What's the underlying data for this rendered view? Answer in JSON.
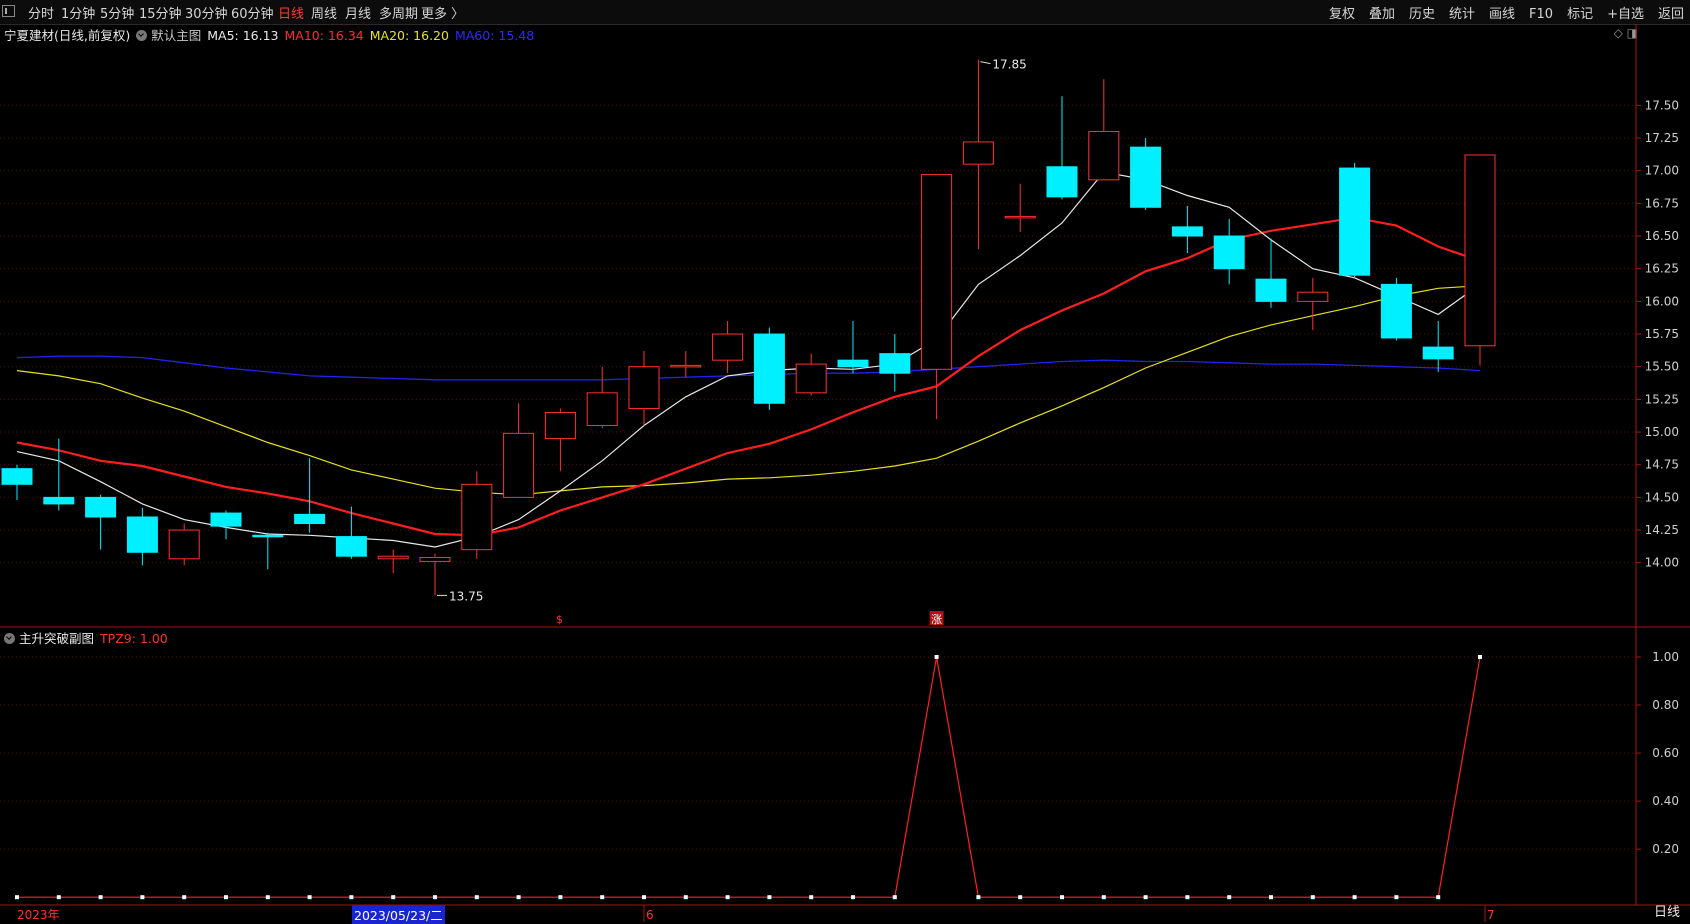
{
  "toolbar": {
    "left": [
      "分时",
      "1分钟",
      "5分钟",
      "15分钟",
      "30分钟",
      "60分钟",
      "日线",
      "周线",
      "月线",
      "多周期",
      "更多 〉"
    ],
    "active_index": 6,
    "right": [
      "复权",
      "叠加",
      "历史",
      "统计",
      "画线",
      "F10",
      "标记",
      "+自选",
      "返回"
    ]
  },
  "header": {
    "stock": "宁夏建材(日线,前复权)",
    "chart_name": "默认主图",
    "ma5": "MA5: 16.13",
    "ma10": "MA10: 16.34",
    "ma20": "MA20: 16.20",
    "ma60": "MA60: 15.48"
  },
  "sub": {
    "name": "主升突破副图",
    "tpz": "TPZ9: 1.00"
  },
  "annotations": {
    "high": "17.85",
    "low": "13.75"
  },
  "signal_marks": [
    "$",
    "涨"
  ],
  "xaxis": {
    "year": "2023年",
    "selected_date": "2023/05/23/二",
    "m6": "6",
    "m7": "7"
  },
  "bottom_right": "日线",
  "colors": {
    "up": "#ff3030",
    "down": "#00f0ff",
    "ma5": "#e8e8e8",
    "ma10": "#ff1e1e",
    "ma20": "#e6e01a",
    "ma60": "#2222ee"
  },
  "chart_data": [
    {
      "type": "candlestick",
      "y_ticks": [
        14.0,
        14.25,
        14.5,
        14.75,
        15.0,
        15.25,
        15.5,
        15.75,
        16.0,
        16.25,
        16.5,
        16.75,
        17.0,
        17.25,
        17.5
      ],
      "ylim": [
        13.6,
        18.0
      ],
      "candles": [
        {
          "o": 14.72,
          "h": 14.75,
          "l": 14.48,
          "c": 14.6
        },
        {
          "o": 14.5,
          "h": 14.95,
          "l": 14.4,
          "c": 14.45
        },
        {
          "o": 14.5,
          "h": 14.52,
          "l": 14.1,
          "c": 14.35
        },
        {
          "o": 14.35,
          "h": 14.42,
          "l": 13.98,
          "c": 14.08
        },
        {
          "o": 14.03,
          "h": 14.3,
          "l": 13.98,
          "c": 14.25
        },
        {
          "o": 14.38,
          "h": 14.4,
          "l": 14.18,
          "c": 14.28
        },
        {
          "o": 14.21,
          "h": 14.23,
          "l": 13.95,
          "c": 14.2
        },
        {
          "o": 14.37,
          "h": 14.8,
          "l": 14.23,
          "c": 14.3
        },
        {
          "o": 14.2,
          "h": 14.43,
          "l": 14.03,
          "c": 14.05
        },
        {
          "o": 14.03,
          "h": 14.1,
          "l": 13.92,
          "c": 14.05
        },
        {
          "o": 14.01,
          "h": 14.07,
          "l": 13.75,
          "c": 14.04
        },
        {
          "o": 14.1,
          "h": 14.7,
          "l": 14.03,
          "c": 14.6
        },
        {
          "o": 14.5,
          "h": 15.22,
          "l": 14.5,
          "c": 14.99
        },
        {
          "o": 14.95,
          "h": 15.18,
          "l": 14.7,
          "c": 15.15
        },
        {
          "o": 15.05,
          "h": 15.5,
          "l": 15.03,
          "c": 15.3
        },
        {
          "o": 15.18,
          "h": 15.62,
          "l": 15.05,
          "c": 15.5
        },
        {
          "o": 15.51,
          "h": 15.62,
          "l": 15.42,
          "c": 15.51
        },
        {
          "o": 15.55,
          "h": 15.85,
          "l": 15.45,
          "c": 15.75
        },
        {
          "o": 15.75,
          "h": 15.8,
          "l": 15.17,
          "c": 15.22
        },
        {
          "o": 15.3,
          "h": 15.6,
          "l": 15.28,
          "c": 15.52
        },
        {
          "o": 15.55,
          "h": 15.85,
          "l": 15.45,
          "c": 15.5
        },
        {
          "o": 15.6,
          "h": 15.75,
          "l": 15.31,
          "c": 15.45
        },
        {
          "o": 15.48,
          "h": 16.97,
          "l": 15.1,
          "c": 16.97
        },
        {
          "o": 17.05,
          "h": 17.85,
          "l": 16.4,
          "c": 17.22
        },
        {
          "o": 16.65,
          "h": 16.9,
          "l": 16.53,
          "c": 16.65
        },
        {
          "o": 17.03,
          "h": 17.57,
          "l": 16.78,
          "c": 16.8
        },
        {
          "o": 16.93,
          "h": 17.7,
          "l": 16.93,
          "c": 17.3
        },
        {
          "o": 17.18,
          "h": 17.25,
          "l": 16.7,
          "c": 16.72
        },
        {
          "o": 16.57,
          "h": 16.73,
          "l": 16.37,
          "c": 16.5
        },
        {
          "o": 16.5,
          "h": 16.63,
          "l": 16.13,
          "c": 16.25
        },
        {
          "o": 16.17,
          "h": 16.48,
          "l": 15.95,
          "c": 16.0
        },
        {
          "o": 16.0,
          "h": 16.18,
          "l": 15.78,
          "c": 16.07
        },
        {
          "o": 17.02,
          "h": 17.06,
          "l": 16.18,
          "c": 16.2
        },
        {
          "o": 16.13,
          "h": 16.18,
          "l": 15.7,
          "c": 15.72
        },
        {
          "o": 15.65,
          "h": 15.85,
          "l": 15.46,
          "c": 15.56
        },
        {
          "o": 15.66,
          "h": 17.12,
          "l": 15.51,
          "c": 17.12
        }
      ],
      "ma5": [
        14.85,
        14.78,
        14.62,
        14.45,
        14.33,
        14.27,
        14.22,
        14.21,
        14.19,
        14.17,
        14.12,
        14.2,
        14.33,
        14.55,
        14.78,
        15.05,
        15.27,
        15.43,
        15.47,
        15.49,
        15.48,
        15.52,
        15.71,
        16.13,
        16.35,
        16.6,
        16.99,
        16.93,
        16.81,
        16.72,
        16.47,
        16.25,
        16.18,
        16.04,
        15.9,
        16.13
      ],
      "ma10": [
        14.92,
        14.86,
        14.78,
        14.74,
        14.66,
        14.58,
        14.53,
        14.47,
        14.38,
        14.3,
        14.22,
        14.21,
        14.27,
        14.4,
        14.5,
        14.6,
        14.72,
        14.84,
        14.91,
        15.02,
        15.15,
        15.27,
        15.35,
        15.58,
        15.78,
        15.93,
        16.06,
        16.23,
        16.33,
        16.47,
        16.54,
        16.59,
        16.64,
        16.58,
        16.42,
        16.31,
        16.34
      ],
      "ma20": [
        15.47,
        15.43,
        15.37,
        15.26,
        15.16,
        15.04,
        14.92,
        14.82,
        14.71,
        14.64,
        14.57,
        14.54,
        14.52,
        14.55,
        14.58,
        14.59,
        14.61,
        14.64,
        14.65,
        14.67,
        14.7,
        14.74,
        14.8,
        14.93,
        15.07,
        15.2,
        15.34,
        15.49,
        15.61,
        15.73,
        15.82,
        15.89,
        15.96,
        16.04,
        16.1,
        16.12,
        16.2
      ],
      "ma60": [
        15.57,
        15.58,
        15.58,
        15.57,
        15.53,
        15.49,
        15.46,
        15.43,
        15.42,
        15.41,
        15.4,
        15.4,
        15.4,
        15.4,
        15.4,
        15.41,
        15.42,
        15.43,
        15.44,
        15.45,
        15.45,
        15.46,
        15.48,
        15.5,
        15.52,
        15.54,
        15.55,
        15.54,
        15.54,
        15.53,
        15.52,
        15.52,
        15.51,
        15.5,
        15.49,
        15.47,
        15.48
      ]
    },
    {
      "type": "line",
      "name": "TPZ9",
      "y_ticks": [
        0.2,
        0.4,
        0.6,
        0.8,
        1.0
      ],
      "ylim": [
        -0.02,
        1.05
      ],
      "values": [
        0,
        0,
        0,
        0,
        0,
        0,
        0,
        0,
        0,
        0,
        0,
        0,
        0,
        0,
        0,
        0,
        0,
        0,
        0,
        0,
        0,
        0,
        1,
        0,
        0,
        0,
        0,
        0,
        0,
        0,
        0,
        0,
        0,
        0,
        0,
        1
      ]
    }
  ]
}
